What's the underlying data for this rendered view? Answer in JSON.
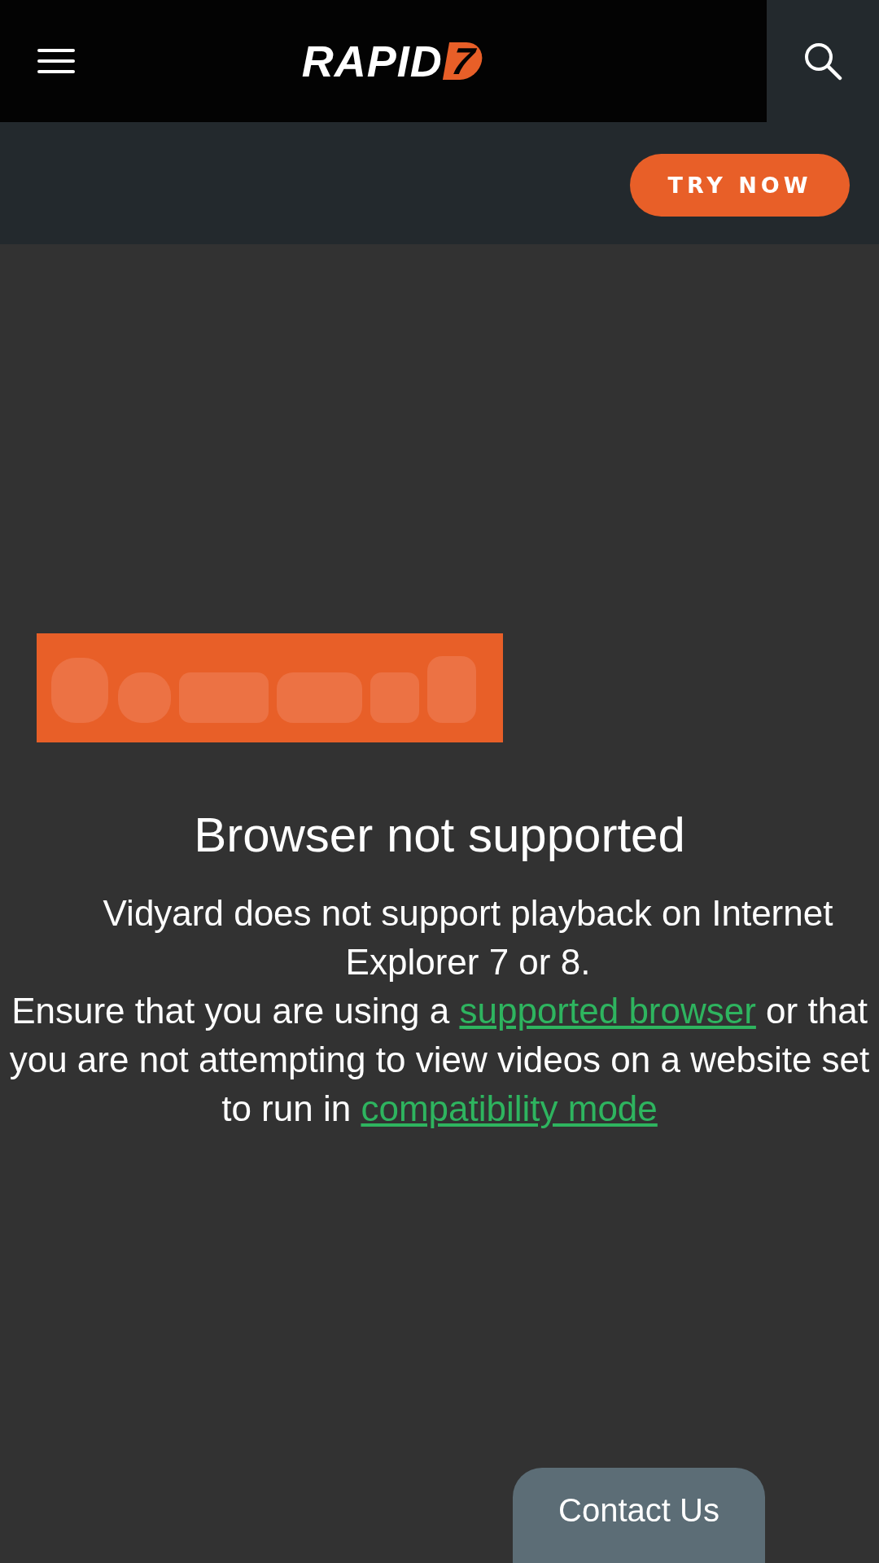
{
  "header": {
    "logo": {
      "word": "RAPID",
      "mark": "7"
    }
  },
  "promo_bar": {
    "button": "TRY NOW"
  },
  "video": {
    "poster": {
      "kind": "picture"
    },
    "title": "Browser not supported",
    "paragraphs": [
      [
        {
          "kind": "text",
          "text": "Vidyard does not support playback on Internet Explorer 7 or 8."
        }
      ],
      [
        {
          "kind": "text",
          "text": "Ensure that you are using a "
        },
        {
          "kind": "link",
          "text": "supported browser"
        },
        {
          "kind": "text",
          "text": " or that you are not attempting to view videos on a website set to run in "
        },
        {
          "kind": "link",
          "text": "compatibility mode"
        }
      ]
    ]
  },
  "contact_tab": "Contact Us"
}
